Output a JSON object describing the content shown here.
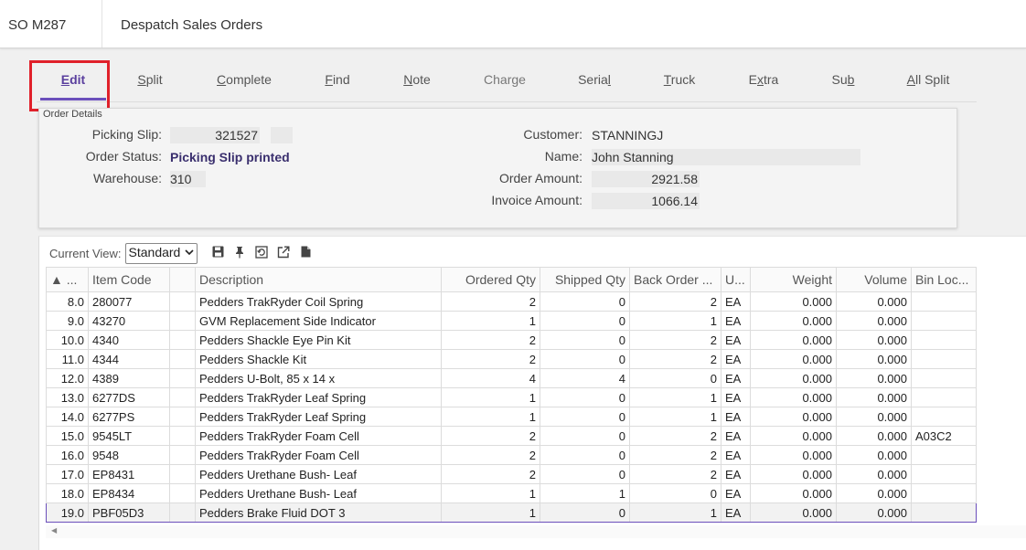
{
  "header": {
    "screen_code": "SO M287",
    "title": "Despatch Sales Orders"
  },
  "toolbar": {
    "tabs": [
      {
        "pre": "",
        "acc": "E",
        "post": "dit",
        "id": "edit"
      },
      {
        "pre": "",
        "acc": "S",
        "post": "plit",
        "id": "split"
      },
      {
        "pre": "",
        "acc": "C",
        "post": "omplete",
        "id": "complete"
      },
      {
        "pre": "",
        "acc": "F",
        "post": "ind",
        "id": "find"
      },
      {
        "pre": "",
        "acc": "N",
        "post": "ote",
        "id": "note"
      },
      {
        "pre": "Charge",
        "acc": "",
        "post": "",
        "id": "charge"
      },
      {
        "pre": "Seria",
        "acc": "l",
        "post": "",
        "id": "serial"
      },
      {
        "pre": "",
        "acc": "T",
        "post": "ruck",
        "id": "truck"
      },
      {
        "pre": "E",
        "acc": "x",
        "post": "tra",
        "id": "extra"
      },
      {
        "pre": "Su",
        "acc": "b",
        "post": "",
        "id": "sub"
      },
      {
        "pre": "",
        "acc": "A",
        "post": "ll Split",
        "id": "all-split"
      }
    ]
  },
  "details": {
    "legend": "Order Details",
    "picking_slip_label": "Picking Slip:",
    "picking_slip": "321527",
    "order_status_label": "Order Status:",
    "order_status": "Picking Slip printed",
    "warehouse_label": "Warehouse:",
    "warehouse": "310",
    "customer_label": "Customer:",
    "customer": "STANNINGJ",
    "name_label": "Name:",
    "name": "John Stanning",
    "order_amount_label": "Order Amount:",
    "order_amount": "2921.58",
    "invoice_amount_label": "Invoice Amount:",
    "invoice_amount": "1066.14"
  },
  "grid": {
    "current_view_label": "Current View:",
    "current_view": "Standard",
    "columns": [
      "▲ ...",
      "Item Code",
      "",
      "Description",
      "Ordered Qty",
      "Shipped Qty",
      "Back Order ...",
      "U...",
      "Weight",
      "Volume",
      "Bin Loc..."
    ],
    "rows": [
      [
        "8.0",
        "280077",
        "",
        "Pedders TrakRyder Coil Spring",
        "2",
        "0",
        "2",
        "EA",
        "0.000",
        "0.000",
        ""
      ],
      [
        "9.0",
        "43270",
        "",
        "GVM Replacement Side Indicator",
        "1",
        "0",
        "1",
        "EA",
        "0.000",
        "0.000",
        ""
      ],
      [
        "10.0",
        "4340",
        "",
        "Pedders Shackle Eye Pin Kit",
        "2",
        "0",
        "2",
        "EA",
        "0.000",
        "0.000",
        ""
      ],
      [
        "11.0",
        "4344",
        "",
        "Pedders Shackle Kit",
        "2",
        "0",
        "2",
        "EA",
        "0.000",
        "0.000",
        ""
      ],
      [
        "12.0",
        "4389",
        "",
        "Pedders U-Bolt, 85 x 14 x",
        "4",
        "4",
        "0",
        "EA",
        "0.000",
        "0.000",
        ""
      ],
      [
        "13.0",
        "6277DS",
        "",
        "Pedders TrakRyder Leaf Spring",
        "1",
        "0",
        "1",
        "EA",
        "0.000",
        "0.000",
        ""
      ],
      [
        "14.0",
        "6277PS",
        "",
        "Pedders TrakRyder Leaf Spring",
        "1",
        "0",
        "1",
        "EA",
        "0.000",
        "0.000",
        ""
      ],
      [
        "15.0",
        "9545LT",
        "",
        "Pedders TrakRyder Foam Cell",
        "2",
        "0",
        "2",
        "EA",
        "0.000",
        "0.000",
        "A03C2"
      ],
      [
        "16.0",
        "9548",
        "",
        "Pedders TrakRyder Foam Cell",
        "2",
        "0",
        "2",
        "EA",
        "0.000",
        "0.000",
        ""
      ],
      [
        "17.0",
        "EP8431",
        "",
        "Pedders Urethane Bush- Leaf",
        "2",
        "0",
        "2",
        "EA",
        "0.000",
        "0.000",
        ""
      ],
      [
        "18.0",
        "EP8434",
        "",
        "Pedders Urethane Bush- Leaf",
        "1",
        "1",
        "0",
        "EA",
        "0.000",
        "0.000",
        ""
      ],
      [
        "19.0",
        "PBF05D3",
        "",
        "Pedders Brake Fluid DOT 3",
        "1",
        "0",
        "1",
        "EA",
        "0.000",
        "0.000",
        ""
      ]
    ]
  },
  "colors": {
    "accent": "#6b4fbb",
    "highlight": "#e0202a"
  },
  "icons": [
    "save-icon",
    "pin-icon",
    "restore-icon",
    "export-icon",
    "document-icon"
  ]
}
